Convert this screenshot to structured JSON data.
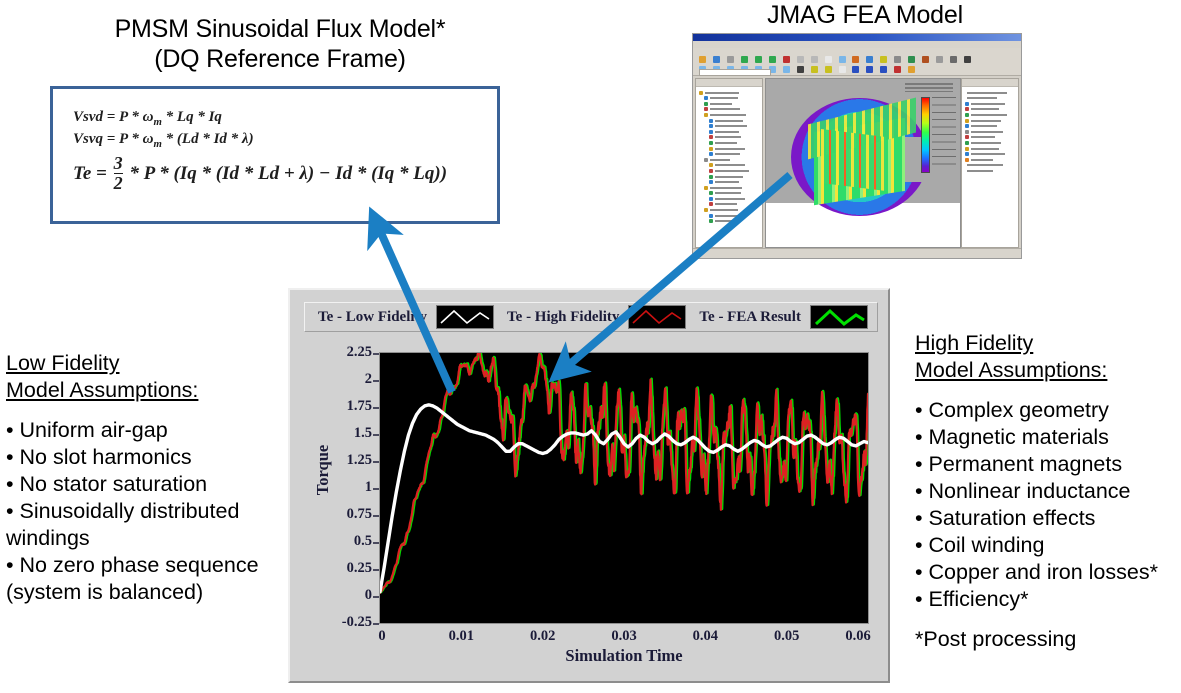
{
  "titles": {
    "pmsm_line1": "PMSM Sinusoidal Flux Model*",
    "pmsm_line2": "(DQ Reference Frame)",
    "jmag": "JMAG FEA Model"
  },
  "equations": {
    "vsvd_pre": "Vsvd = P * ",
    "omega": "ω",
    "omega_sub": "m",
    "vsvd_post": " * Lq * Iq",
    "vsvq_pre": "Vsvq = P * ",
    "vsvq_post": " * (Ld * Id * λ)",
    "te_lhs": "Te = ",
    "frac_num": "3",
    "frac_den": "2",
    "te_rhs": " * P * (Iq * (Id * Ld + λ) − Id * (Iq * Lq))"
  },
  "legend": {
    "items": [
      {
        "label": "Te - Low Fidelity",
        "color": "#ffffff"
      },
      {
        "label": "Te - High Fidelity",
        "color": "#cc1111"
      },
      {
        "label": "Te - FEA Result",
        "color": "#00e000"
      }
    ]
  },
  "left_panel": {
    "heading_line1": "Low Fidelity",
    "heading_line2": "Model Assumptions:",
    "items": [
      "• Uniform air-gap",
      "• No slot harmonics",
      "• No stator saturation",
      "• Sinusoidally distributed windings",
      "• No zero phase sequence (system is balanced)"
    ]
  },
  "right_panel": {
    "heading_line1": "High Fidelity",
    "heading_line2": "Model Assumptions:",
    "items": [
      "• Complex geometry",
      "• Magnetic materials",
      "• Permanent magnets",
      "• Nonlinear inductance",
      "• Saturation effects",
      "• Coil winding",
      "• Copper and iron losses*",
      "• Efficiency*"
    ],
    "note": "*Post processing"
  },
  "colors": {
    "arrow": "#1b7fc4",
    "equation_border": "#3b6398",
    "panel_face": "#d2d2d2",
    "plot_background": "#000000",
    "tick_text": "#1b1b38"
  },
  "chart_data": {
    "type": "line",
    "title": "",
    "xlabel": "Simulation Time",
    "ylabel": "Torque",
    "xlim": [
      0,
      0.06
    ],
    "ylim": [
      -0.25,
      2.25
    ],
    "xticks": [
      0,
      0.01,
      0.02,
      0.03,
      0.04,
      0.05,
      0.06
    ],
    "xtick_labels": [
      "0",
      "0.01",
      "0.02",
      "0.03",
      "0.04",
      "0.05",
      "0.06"
    ],
    "yticks": [
      -0.25,
      0,
      0.25,
      0.5,
      0.75,
      1,
      1.25,
      1.5,
      1.75,
      2,
      2.25
    ],
    "ytick_labels": [
      "-0.25",
      "0",
      "0.25",
      "0.5",
      "0.75",
      "1",
      "1.25",
      "1.5",
      "1.75",
      "2",
      "2.25"
    ],
    "grid": false,
    "legend_position": "top",
    "series": [
      {
        "name": "Te - Low Fidelity",
        "color": "#ffffff",
        "x": [
          0.0,
          0.0005,
          0.001,
          0.0015,
          0.002,
          0.0025,
          0.003,
          0.0035,
          0.004,
          0.0045,
          0.005,
          0.0055,
          0.006,
          0.0065,
          0.007,
          0.0075,
          0.008,
          0.0085,
          0.009,
          0.0095,
          0.01,
          0.0105,
          0.011,
          0.0115,
          0.012,
          0.0125,
          0.013,
          0.0135,
          0.014,
          0.0145,
          0.015,
          0.0155,
          0.016,
          0.0165,
          0.017,
          0.0175,
          0.018,
          0.0185,
          0.019,
          0.0195,
          0.02,
          0.0205,
          0.021,
          0.0215,
          0.022,
          0.0225,
          0.023,
          0.0235,
          0.024,
          0.0245,
          0.025,
          0.0255,
          0.026,
          0.0265,
          0.027,
          0.0275,
          0.028,
          0.0285,
          0.029,
          0.0295,
          0.03,
          0.0305,
          0.031,
          0.0315,
          0.032,
          0.0325,
          0.033,
          0.0335,
          0.034,
          0.0345,
          0.035,
          0.0355,
          0.036,
          0.0365,
          0.037,
          0.0375,
          0.038,
          0.0385,
          0.039,
          0.0395,
          0.04,
          0.0405,
          0.041,
          0.0415,
          0.042,
          0.0425,
          0.043,
          0.0435,
          0.044,
          0.0445,
          0.045,
          0.0455,
          0.046,
          0.0465,
          0.047,
          0.0475,
          0.048,
          0.0485,
          0.049,
          0.0495,
          0.05,
          0.0505,
          0.051,
          0.0515,
          0.052,
          0.0525,
          0.053,
          0.0535,
          0.054,
          0.0545,
          0.055,
          0.0555,
          0.056,
          0.0565,
          0.057,
          0.0575,
          0.058,
          0.0585,
          0.059,
          0.0595,
          0.06
        ],
        "y": [
          0.04,
          0.26,
          0.5,
          0.74,
          0.96,
          1.16,
          1.34,
          1.49,
          1.6,
          1.68,
          1.73,
          1.76,
          1.77,
          1.76,
          1.74,
          1.71,
          1.68,
          1.65,
          1.62,
          1.59,
          1.57,
          1.55,
          1.53,
          1.52,
          1.51,
          1.5,
          1.49,
          1.47,
          1.45,
          1.42,
          1.38,
          1.34,
          1.34,
          1.38,
          1.41,
          1.41,
          1.39,
          1.37,
          1.35,
          1.33,
          1.32,
          1.33,
          1.36,
          1.4,
          1.45,
          1.48,
          1.5,
          1.51,
          1.51,
          1.5,
          1.49,
          1.5,
          1.53,
          1.49,
          1.43,
          1.41,
          1.45,
          1.5,
          1.52,
          1.47,
          1.41,
          1.38,
          1.41,
          1.46,
          1.49,
          1.47,
          1.43,
          1.41,
          1.43,
          1.47,
          1.5,
          1.48,
          1.44,
          1.41,
          1.4,
          1.42,
          1.45,
          1.47,
          1.45,
          1.41,
          1.37,
          1.34,
          1.33,
          1.35,
          1.38,
          1.4,
          1.39,
          1.36,
          1.34,
          1.36,
          1.39,
          1.42,
          1.44,
          1.43,
          1.4,
          1.38,
          1.39,
          1.42,
          1.45,
          1.47,
          1.46,
          1.43,
          1.41,
          1.42,
          1.45,
          1.48,
          1.49,
          1.47,
          1.44,
          1.41,
          1.4,
          1.42,
          1.45,
          1.47,
          1.46,
          1.43,
          1.4,
          1.39,
          1.41,
          1.43,
          1.42
        ]
      },
      {
        "name": "Te - High Fidelity",
        "color": "#dd2222",
        "note": "oscillatory trace, nearly coincident with FEA result"
      },
      {
        "name": "Te - FEA Result",
        "color": "#00dd00",
        "note": "oscillatory trace, nearly coincident with high fidelity"
      }
    ],
    "envelope": {
      "x": [
        0.0,
        0.001,
        0.002,
        0.003,
        0.004,
        0.005,
        0.006,
        0.007,
        0.008,
        0.009,
        0.01,
        0.011,
        0.012,
        0.0125,
        0.013,
        0.014,
        0.015,
        0.016,
        0.0165,
        0.017,
        0.018,
        0.019,
        0.0195,
        0.02,
        0.0205,
        0.021,
        0.022,
        0.023,
        0.024,
        0.025,
        0.026,
        0.027,
        0.028,
        0.029,
        0.03,
        0.032,
        0.034,
        0.036,
        0.038,
        0.04,
        0.042,
        0.044,
        0.046,
        0.048,
        0.05,
        0.052,
        0.054,
        0.056,
        0.058,
        0.06
      ],
      "mean": [
        0.02,
        0.12,
        0.3,
        0.52,
        0.78,
        1.04,
        1.3,
        1.55,
        1.78,
        1.96,
        2.08,
        2.15,
        2.17,
        2.16,
        2.12,
        2.0,
        1.78,
        1.5,
        1.42,
        1.48,
        1.8,
        2.05,
        2.12,
        2.1,
        2.02,
        1.9,
        1.66,
        1.5,
        1.46,
        1.52,
        1.58,
        1.55,
        1.48,
        1.44,
        1.46,
        1.48,
        1.45,
        1.42,
        1.4,
        1.38,
        1.36,
        1.36,
        1.37,
        1.38,
        1.38,
        1.37,
        1.36,
        1.36,
        1.35,
        1.35
      ],
      "amplitude": [
        0.02,
        0.03,
        0.04,
        0.05,
        0.05,
        0.06,
        0.06,
        0.07,
        0.07,
        0.07,
        0.08,
        0.08,
        0.09,
        0.1,
        0.12,
        0.18,
        0.28,
        0.34,
        0.32,
        0.26,
        0.18,
        0.12,
        0.1,
        0.12,
        0.18,
        0.26,
        0.34,
        0.38,
        0.4,
        0.4,
        0.4,
        0.42,
        0.44,
        0.44,
        0.44,
        0.44,
        0.44,
        0.45,
        0.45,
        0.45,
        0.45,
        0.44,
        0.44,
        0.44,
        0.44,
        0.44,
        0.44,
        0.44,
        0.44,
        0.44
      ],
      "ripple_frequency_hz": 520
    }
  }
}
